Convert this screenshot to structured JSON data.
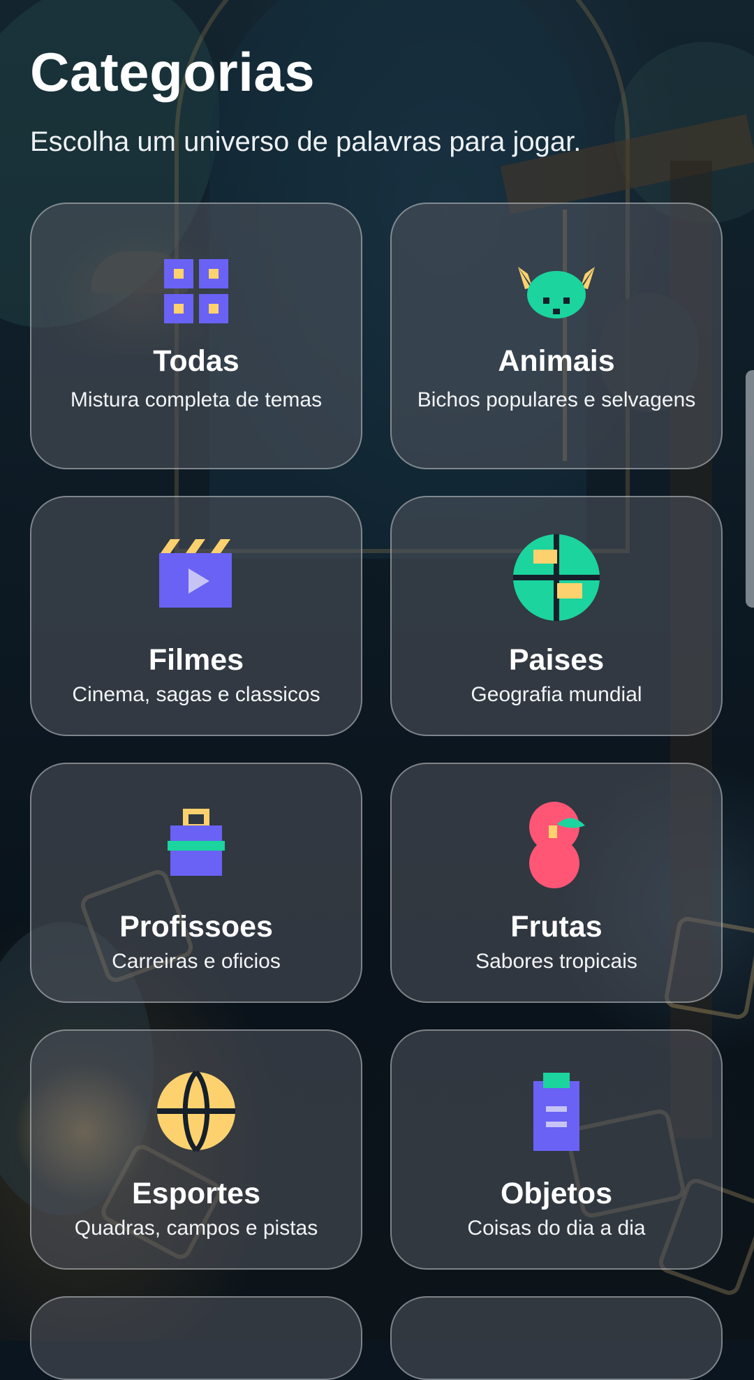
{
  "page": {
    "title": "Categorias",
    "subtitle": "Escolha um universo de palavras para jogar."
  },
  "colors": {
    "purple": "#6962F5",
    "yellow": "#FDD26E",
    "green": "#1BD49E",
    "pink": "#FF5675",
    "dark": "#16202B",
    "lavender": "#C7C4F5"
  },
  "categories": [
    {
      "name": "Todas",
      "description": "Mistura completa de temas",
      "icon": "grid-icon"
    },
    {
      "name": "Animais",
      "description": "Bichos populares e selvagens",
      "icon": "animal-face-icon"
    },
    {
      "name": "Filmes",
      "description": "Cinema, sagas e classicos",
      "icon": "clapperboard-icon"
    },
    {
      "name": "Paises",
      "description": "Geografia mundial",
      "icon": "globe-icon"
    },
    {
      "name": "Profissoes",
      "description": "Carreiras e oficios",
      "icon": "briefcase-icon"
    },
    {
      "name": "Frutas",
      "description": "Sabores tropicais",
      "icon": "fruit-icon"
    },
    {
      "name": "Esportes",
      "description": "Quadras, campos e pistas",
      "icon": "ball-icon"
    },
    {
      "name": "Objetos",
      "description": "Coisas do dia a dia",
      "icon": "clipboard-icon"
    }
  ]
}
